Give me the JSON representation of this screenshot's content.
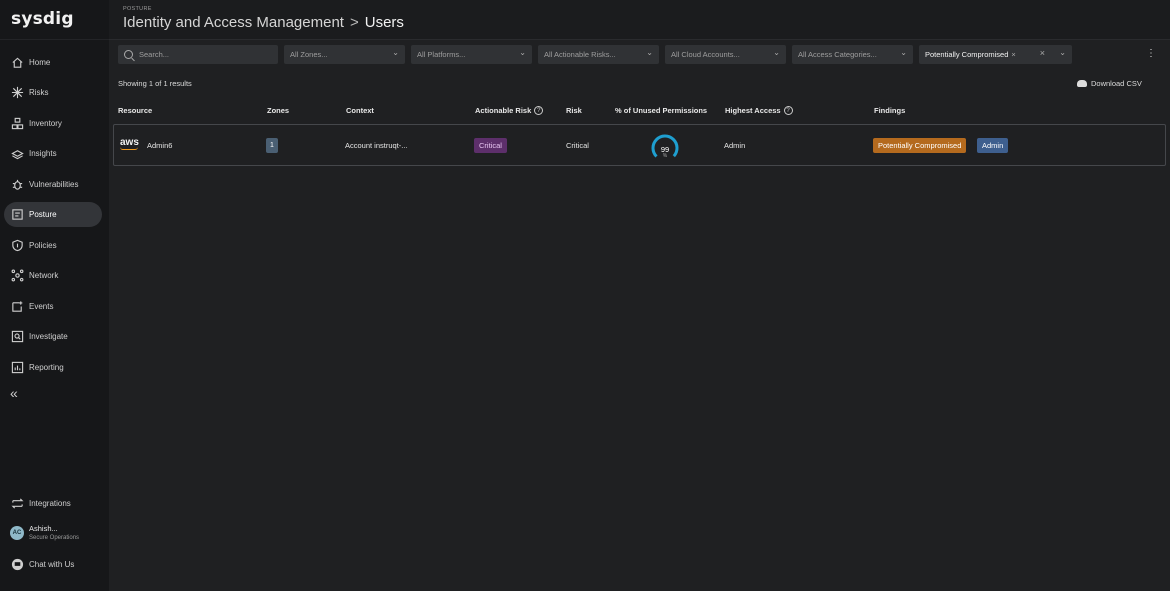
{
  "app": {
    "logo": "sysdig"
  },
  "nav": {
    "items": [
      {
        "label": "Home",
        "icon": "home-icon"
      },
      {
        "label": "Risks",
        "icon": "risks-icon"
      },
      {
        "label": "Inventory",
        "icon": "inventory-icon"
      },
      {
        "label": "Insights",
        "icon": "insights-icon"
      },
      {
        "label": "Vulnerabilities",
        "icon": "vulnerabilities-icon"
      },
      {
        "label": "Posture",
        "icon": "posture-icon",
        "active": true
      },
      {
        "label": "Policies",
        "icon": "policies-icon"
      },
      {
        "label": "Network",
        "icon": "network-icon"
      },
      {
        "label": "Events",
        "icon": "events-icon"
      },
      {
        "label": "Investigate",
        "icon": "investigate-icon"
      },
      {
        "label": "Reporting",
        "icon": "reporting-icon"
      }
    ],
    "collapse": "«",
    "integrations": "Integrations",
    "user": {
      "initials": "AC",
      "name": "Ashish...",
      "role": "Secure Operations"
    },
    "chat": "Chat with Us"
  },
  "header": {
    "breadcrumb": "POSTURE",
    "title": "Identity and Access Management",
    "separator": ">",
    "current": "Users"
  },
  "filters": {
    "search_placeholder": "Search...",
    "zones": "All Zones...",
    "platforms": "All Platforms...",
    "actionable_risks": "All Actionable Risks...",
    "cloud_accounts": "All Cloud Accounts...",
    "access_categories": "All Access Categories...",
    "active_filter": "Potentially Compromised",
    "remove": "×",
    "clear": "×",
    "more": "⋮"
  },
  "results": {
    "summary": "Showing 1 of 1 results",
    "download": "Download CSV"
  },
  "table": {
    "columns": {
      "resource": "Resource",
      "zones": "Zones",
      "context": "Context",
      "actionable_risk": "Actionable Risk",
      "risk": "Risk",
      "unused": "% of Unused Permissions",
      "highest_access": "Highest Access",
      "findings": "Findings"
    },
    "rows": [
      {
        "provider": "aws",
        "resource": "Admin6",
        "zones": "1",
        "context": "Account  instruqt-...",
        "actionable_risk": "Critical",
        "risk": "Critical",
        "unused_pct": 99,
        "unused_pct_label": "99",
        "unused_unit": "%",
        "highest_access": "Admin",
        "findings": [
          "Potentially Compromised",
          "Admin"
        ]
      }
    ]
  },
  "colors": {
    "critical_bg": "#5d2f6b",
    "compromised_bg": "#b46a1e",
    "admin_bg": "#3e5f8e",
    "gauge": "#1e9fd0"
  }
}
